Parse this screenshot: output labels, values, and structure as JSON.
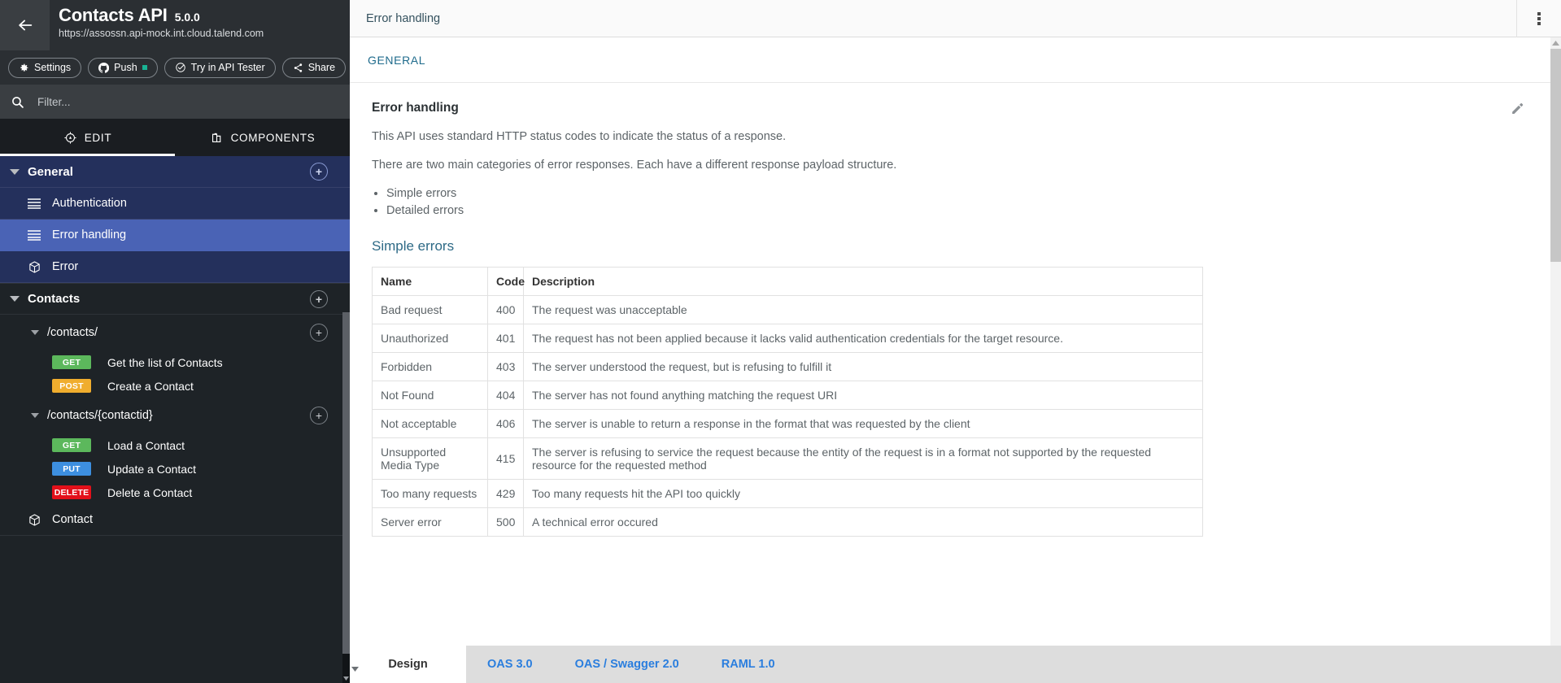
{
  "sidebar": {
    "back_icon": "back-arrow-icon",
    "api_title": "Contacts API",
    "api_version": "5.0.0",
    "api_url": "https://assossn.api-mock.int.cloud.talend.com",
    "toolbar": {
      "settings_label": "Settings",
      "push_label": "Push",
      "try_label": "Try in API Tester",
      "share_label": "Share",
      "add_label": "+"
    },
    "filter": {
      "placeholder": "Filter...",
      "value": ""
    },
    "tabs": [
      {
        "label": "EDIT",
        "icon": "compass-icon",
        "active": true
      },
      {
        "label": "COMPONENTS",
        "icon": "components-icon",
        "active": false
      }
    ],
    "tree": {
      "general": {
        "label": "General",
        "items": [
          {
            "label": "Authentication",
            "icon": "list-icon",
            "selected": false
          },
          {
            "label": "Error handling",
            "icon": "list-icon",
            "selected": true
          },
          {
            "label": "Error",
            "icon": "cube-icon",
            "selected": false
          }
        ]
      },
      "contacts": {
        "label": "Contacts",
        "paths": [
          {
            "path": "/contacts/",
            "operations": [
              {
                "method": "GET",
                "label": "Get the list of Contacts",
                "color": "#5cb85c"
              },
              {
                "method": "POST",
                "label": "Create a Contact",
                "color": "#f0ad2e"
              }
            ]
          },
          {
            "path": "/contacts/{contactid}",
            "operations": [
              {
                "method": "GET",
                "label": "Load a Contact",
                "color": "#5cb85c"
              },
              {
                "method": "PUT",
                "label": "Update a Contact",
                "color": "#3d8fe0"
              },
              {
                "method": "DELETE",
                "label": "Delete a Contact",
                "color": "#e3101a"
              }
            ]
          }
        ],
        "models": [
          {
            "label": "Contact",
            "icon": "cube-icon"
          }
        ]
      }
    }
  },
  "main": {
    "top_title": "Error handling",
    "kebab_icon": "kebab-menu-icon",
    "section_label": "GENERAL",
    "doc": {
      "title": "Error handling",
      "edit_icon": "pencil-edit-icon",
      "paragraphs": [
        "This API uses standard HTTP status codes to indicate the status of a response.",
        "There are two main categories of error responses. Each have a different response payload structure."
      ],
      "bullets": [
        "Simple errors",
        "Detailed errors"
      ],
      "subheading": "Simple errors"
    },
    "table": {
      "headers": [
        "Name",
        "Code",
        "Description"
      ],
      "rows": [
        [
          "Bad request",
          "400",
          "The request was unacceptable"
        ],
        [
          "Unauthorized",
          "401",
          "The request has not been applied because it lacks valid authentication credentials for the target resource."
        ],
        [
          "Forbidden",
          "403",
          "The server understood the request, but is refusing to fulfill it"
        ],
        [
          "Not Found",
          "404",
          "The server has not found anything matching the request URI"
        ],
        [
          "Not acceptable",
          "406",
          "The server is unable to return a response in the format that was requested by the client"
        ],
        [
          "Unsupported Media Type",
          "415",
          "The server is refusing to service the request because the entity of the request is in a format not supported by the requested resource for the requested method"
        ],
        [
          "Too many requests",
          "429",
          "Too many requests hit the API too quickly"
        ],
        [
          "Server error",
          "500",
          "A technical error occured"
        ]
      ]
    },
    "bottom_tabs": [
      {
        "label": "Design",
        "active": true
      },
      {
        "label": "OAS 3.0",
        "active": false
      },
      {
        "label": "OAS / Swagger 2.0",
        "active": false
      },
      {
        "label": "RAML 1.0",
        "active": false
      }
    ]
  },
  "colors": {
    "sidebar_bg": "#1e2327",
    "selected_blue": "#4a63b5",
    "group_blue": "#24305c",
    "link_blue": "#2a7ede",
    "heading_teal": "#2e6a86"
  }
}
